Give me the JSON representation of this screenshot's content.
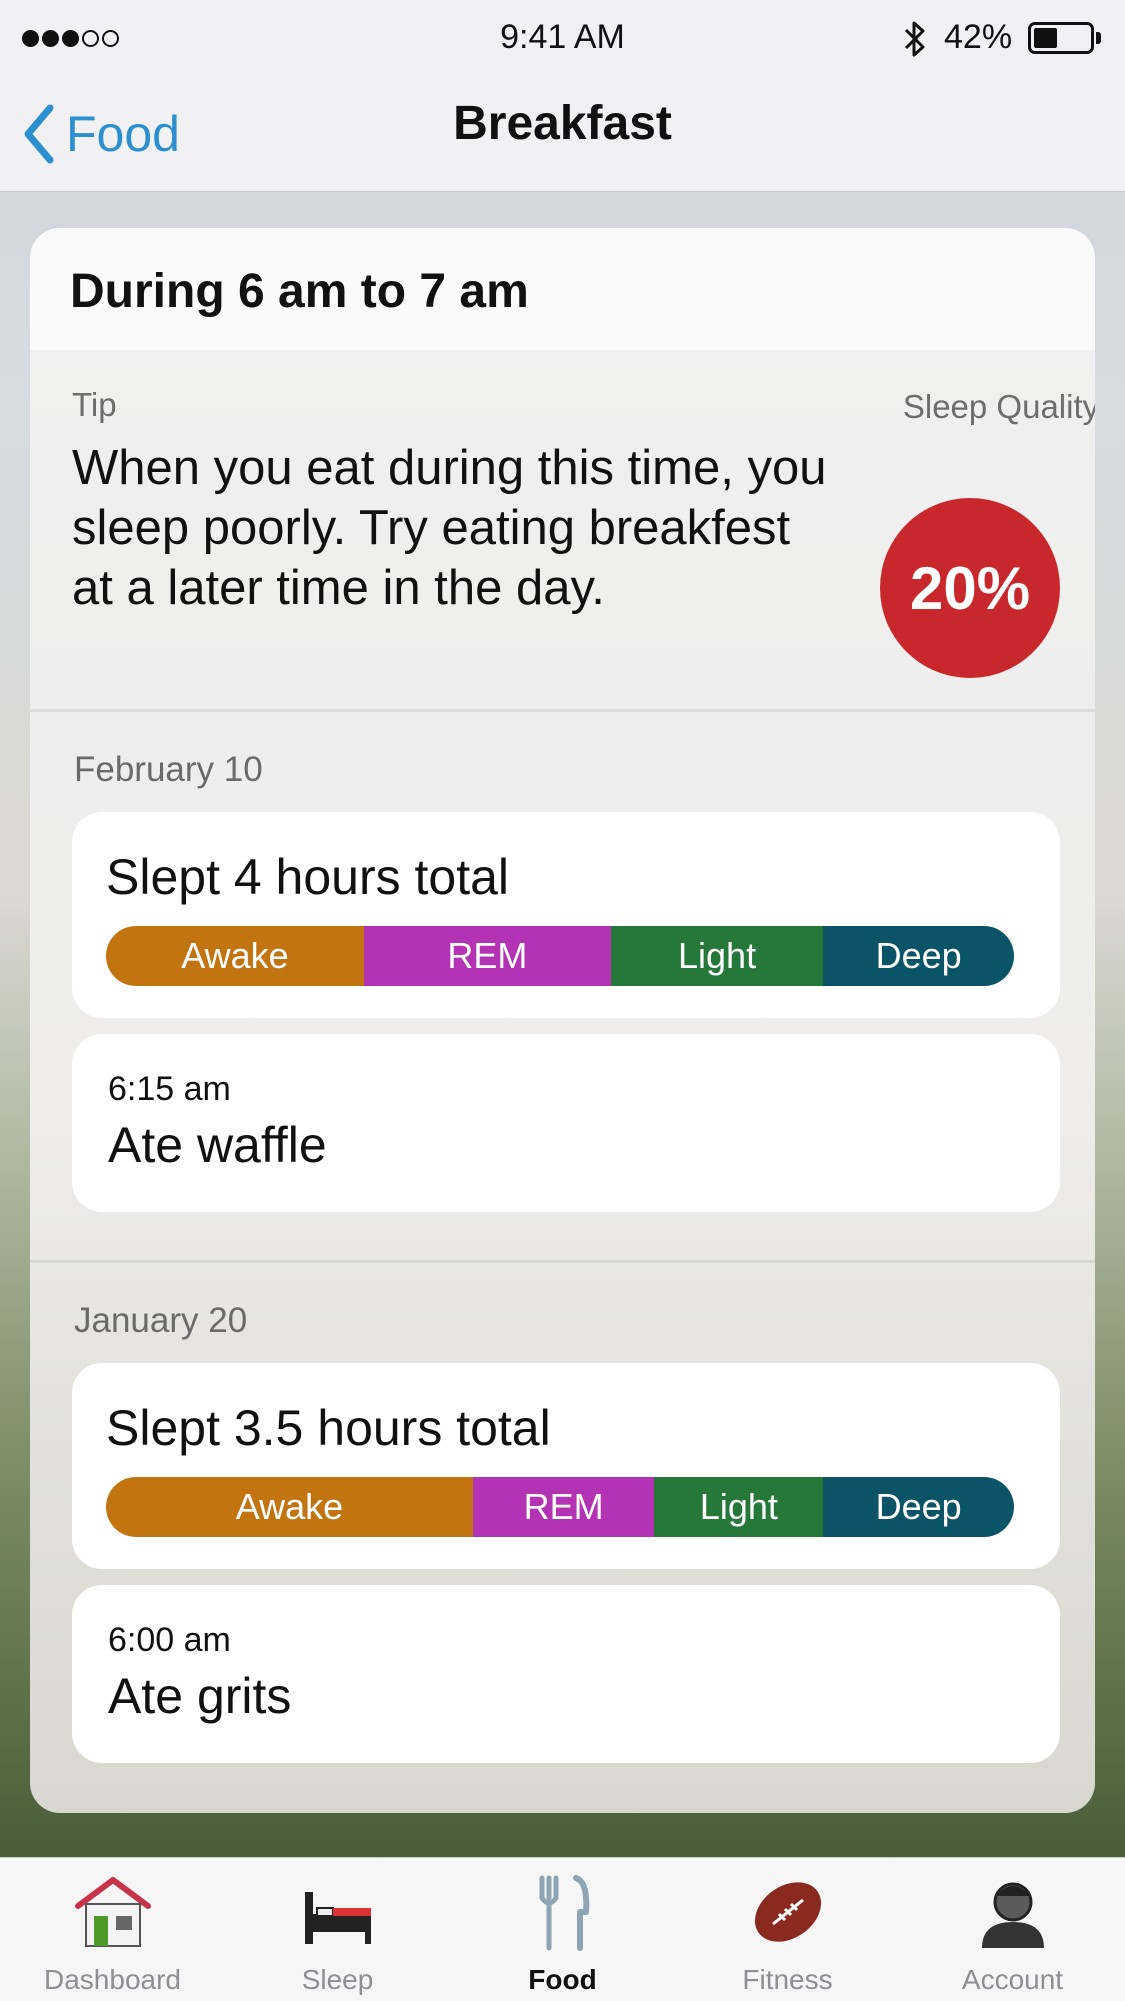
{
  "status_bar": {
    "signal_dots": [
      true,
      true,
      true,
      false,
      false
    ],
    "time": "9:41 AM",
    "battery_percent": "42%",
    "battery_level": 0.42,
    "bluetooth_icon": "bluetooth-icon"
  },
  "nav": {
    "back_label": "Food",
    "title": "Breakfast"
  },
  "card": {
    "title": "During 6 am to 7 am",
    "tip_label": "Tip",
    "tip_text": "When you eat during this time, you sleep poorly. Try eating breakfest at a later time in the day.",
    "sleep_quality_label": "Sleep Quality",
    "sleep_quality_value": "20%"
  },
  "days": [
    {
      "date": "February 10",
      "sleep_summary": "Slept 4 hours total",
      "stages": [
        {
          "label": "Awake",
          "fraction": 0.284,
          "color": "#c27410"
        },
        {
          "label": "REM",
          "fraction": 0.272,
          "color": "#b333b4"
        },
        {
          "label": "Light",
          "fraction": 0.234,
          "color": "#267838"
        },
        {
          "label": "Deep",
          "fraction": 0.21,
          "color": "#0b5468"
        }
      ],
      "meal_time": "6:15 am",
      "meal": "Ate waffle"
    },
    {
      "date": "January 20",
      "sleep_summary": "Slept 3.5 hours total",
      "stages": [
        {
          "label": "Awake",
          "fraction": 0.404,
          "color": "#c27410"
        },
        {
          "label": "REM",
          "fraction": 0.2,
          "color": "#b333b4"
        },
        {
          "label": "Light",
          "fraction": 0.186,
          "color": "#267838"
        },
        {
          "label": "Deep",
          "fraction": 0.21,
          "color": "#0b5468"
        }
      ],
      "meal_time": "6:00 am",
      "meal": "Ate grits"
    }
  ],
  "tabs": [
    {
      "label": "Dashboard",
      "icon": "house-icon",
      "active": false
    },
    {
      "label": "Sleep",
      "icon": "bed-icon",
      "active": false
    },
    {
      "label": "Food",
      "icon": "fork-knife-icon",
      "active": true
    },
    {
      "label": "Fitness",
      "icon": "football-icon",
      "active": false
    },
    {
      "label": "Account",
      "icon": "person-icon",
      "active": false
    }
  ],
  "colors": {
    "accent": "#2b8fd0",
    "sleep_quality_badge": "#c8282b"
  }
}
